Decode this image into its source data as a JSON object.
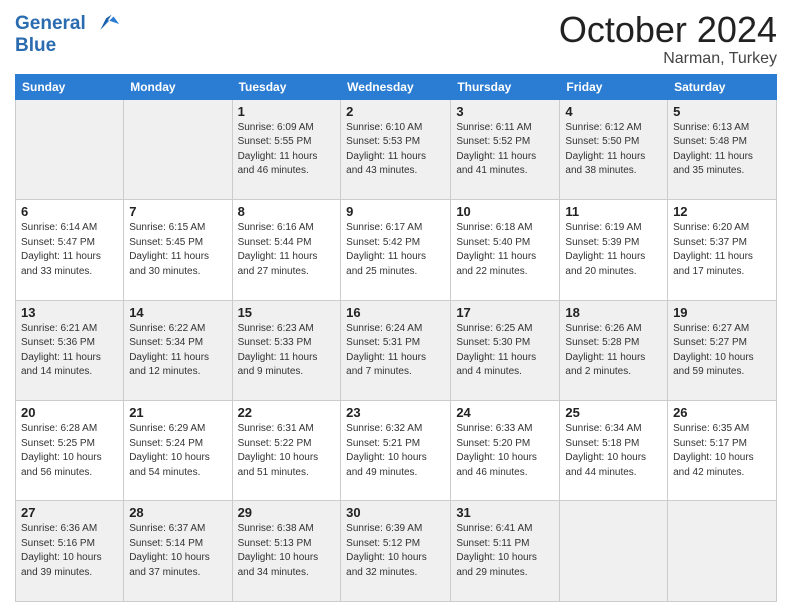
{
  "logo": {
    "line1": "General",
    "line2": "Blue"
  },
  "header": {
    "month": "October 2024",
    "location": "Narman, Turkey"
  },
  "weekdays": [
    "Sunday",
    "Monday",
    "Tuesday",
    "Wednesday",
    "Thursday",
    "Friday",
    "Saturday"
  ],
  "weeks": [
    [
      {
        "day": "",
        "info": ""
      },
      {
        "day": "",
        "info": ""
      },
      {
        "day": "1",
        "info": "Sunrise: 6:09 AM\nSunset: 5:55 PM\nDaylight: 11 hours and 46 minutes."
      },
      {
        "day": "2",
        "info": "Sunrise: 6:10 AM\nSunset: 5:53 PM\nDaylight: 11 hours and 43 minutes."
      },
      {
        "day": "3",
        "info": "Sunrise: 6:11 AM\nSunset: 5:52 PM\nDaylight: 11 hours and 41 minutes."
      },
      {
        "day": "4",
        "info": "Sunrise: 6:12 AM\nSunset: 5:50 PM\nDaylight: 11 hours and 38 minutes."
      },
      {
        "day": "5",
        "info": "Sunrise: 6:13 AM\nSunset: 5:48 PM\nDaylight: 11 hours and 35 minutes."
      }
    ],
    [
      {
        "day": "6",
        "info": "Sunrise: 6:14 AM\nSunset: 5:47 PM\nDaylight: 11 hours and 33 minutes."
      },
      {
        "day": "7",
        "info": "Sunrise: 6:15 AM\nSunset: 5:45 PM\nDaylight: 11 hours and 30 minutes."
      },
      {
        "day": "8",
        "info": "Sunrise: 6:16 AM\nSunset: 5:44 PM\nDaylight: 11 hours and 27 minutes."
      },
      {
        "day": "9",
        "info": "Sunrise: 6:17 AM\nSunset: 5:42 PM\nDaylight: 11 hours and 25 minutes."
      },
      {
        "day": "10",
        "info": "Sunrise: 6:18 AM\nSunset: 5:40 PM\nDaylight: 11 hours and 22 minutes."
      },
      {
        "day": "11",
        "info": "Sunrise: 6:19 AM\nSunset: 5:39 PM\nDaylight: 11 hours and 20 minutes."
      },
      {
        "day": "12",
        "info": "Sunrise: 6:20 AM\nSunset: 5:37 PM\nDaylight: 11 hours and 17 minutes."
      }
    ],
    [
      {
        "day": "13",
        "info": "Sunrise: 6:21 AM\nSunset: 5:36 PM\nDaylight: 11 hours and 14 minutes."
      },
      {
        "day": "14",
        "info": "Sunrise: 6:22 AM\nSunset: 5:34 PM\nDaylight: 11 hours and 12 minutes."
      },
      {
        "day": "15",
        "info": "Sunrise: 6:23 AM\nSunset: 5:33 PM\nDaylight: 11 hours and 9 minutes."
      },
      {
        "day": "16",
        "info": "Sunrise: 6:24 AM\nSunset: 5:31 PM\nDaylight: 11 hours and 7 minutes."
      },
      {
        "day": "17",
        "info": "Sunrise: 6:25 AM\nSunset: 5:30 PM\nDaylight: 11 hours and 4 minutes."
      },
      {
        "day": "18",
        "info": "Sunrise: 6:26 AM\nSunset: 5:28 PM\nDaylight: 11 hours and 2 minutes."
      },
      {
        "day": "19",
        "info": "Sunrise: 6:27 AM\nSunset: 5:27 PM\nDaylight: 10 hours and 59 minutes."
      }
    ],
    [
      {
        "day": "20",
        "info": "Sunrise: 6:28 AM\nSunset: 5:25 PM\nDaylight: 10 hours and 56 minutes."
      },
      {
        "day": "21",
        "info": "Sunrise: 6:29 AM\nSunset: 5:24 PM\nDaylight: 10 hours and 54 minutes."
      },
      {
        "day": "22",
        "info": "Sunrise: 6:31 AM\nSunset: 5:22 PM\nDaylight: 10 hours and 51 minutes."
      },
      {
        "day": "23",
        "info": "Sunrise: 6:32 AM\nSunset: 5:21 PM\nDaylight: 10 hours and 49 minutes."
      },
      {
        "day": "24",
        "info": "Sunrise: 6:33 AM\nSunset: 5:20 PM\nDaylight: 10 hours and 46 minutes."
      },
      {
        "day": "25",
        "info": "Sunrise: 6:34 AM\nSunset: 5:18 PM\nDaylight: 10 hours and 44 minutes."
      },
      {
        "day": "26",
        "info": "Sunrise: 6:35 AM\nSunset: 5:17 PM\nDaylight: 10 hours and 42 minutes."
      }
    ],
    [
      {
        "day": "27",
        "info": "Sunrise: 6:36 AM\nSunset: 5:16 PM\nDaylight: 10 hours and 39 minutes."
      },
      {
        "day": "28",
        "info": "Sunrise: 6:37 AM\nSunset: 5:14 PM\nDaylight: 10 hours and 37 minutes."
      },
      {
        "day": "29",
        "info": "Sunrise: 6:38 AM\nSunset: 5:13 PM\nDaylight: 10 hours and 34 minutes."
      },
      {
        "day": "30",
        "info": "Sunrise: 6:39 AM\nSunset: 5:12 PM\nDaylight: 10 hours and 32 minutes."
      },
      {
        "day": "31",
        "info": "Sunrise: 6:41 AM\nSunset: 5:11 PM\nDaylight: 10 hours and 29 minutes."
      },
      {
        "day": "",
        "info": ""
      },
      {
        "day": "",
        "info": ""
      }
    ]
  ]
}
